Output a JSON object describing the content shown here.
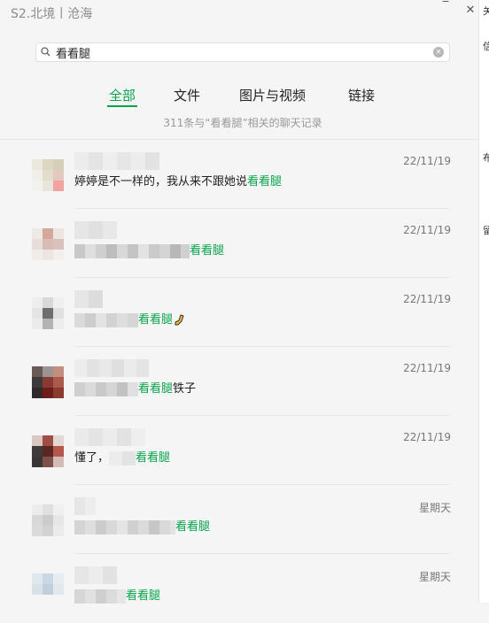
{
  "window": {
    "title": "S2.北境丨沧海"
  },
  "search": {
    "value": "看看腿",
    "clear_label": "×"
  },
  "tabs": [
    "全部",
    "文件",
    "图片与视频",
    "链接"
  ],
  "result_count": "311条与“看看腿”相关的聊天记录",
  "colors": {
    "accent": "#07a34a",
    "background": "#f5f5f5",
    "date": "#777777"
  },
  "results": [
    {
      "date": "22/11/19",
      "msg_before": "婷婷是不一样的，我从来不跟她说",
      "highlight": "看看腿",
      "msg_after": ""
    },
    {
      "date": "22/11/19",
      "msg_before": "",
      "highlight": "看看腿",
      "msg_after": ""
    },
    {
      "date": "22/11/19",
      "msg_before": "",
      "highlight": "看看腿",
      "msg_after": "",
      "emoji": "leg-emoji"
    },
    {
      "date": "22/11/19",
      "msg_before": "",
      "highlight": "看看腿",
      "msg_after": "铁子"
    },
    {
      "date": "22/11/19",
      "msg_before": "懂了，",
      "highlight": "看看腿",
      "msg_after": ""
    },
    {
      "date": "星期天",
      "msg_before": "",
      "highlight": "看看腿",
      "msg_after": ""
    },
    {
      "date": "星期天",
      "msg_before": "",
      "highlight": "看看腿",
      "msg_after": ""
    }
  ]
}
